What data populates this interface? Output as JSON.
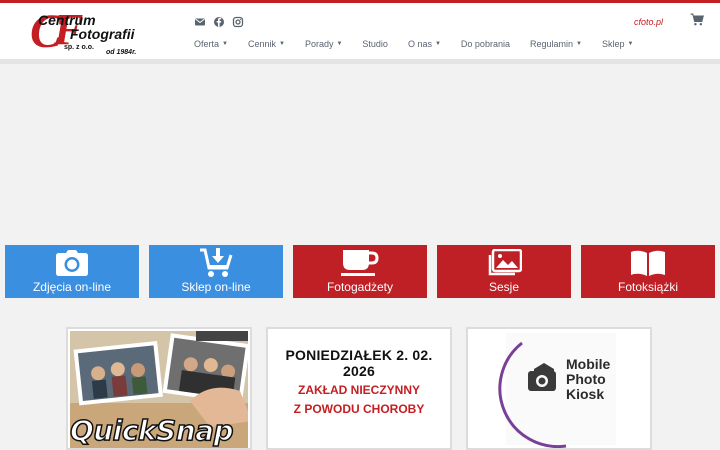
{
  "header": {
    "logo": {
      "line1": "Centrum",
      "line2": "Fotografii",
      "company": "sp. z o.o.",
      "since": "od 1984r."
    },
    "social": [
      {
        "icon": "envelope-icon"
      },
      {
        "icon": "facebook-icon"
      },
      {
        "icon": "instagram-icon"
      }
    ],
    "nav": [
      {
        "label": "Oferta",
        "dropdown": true
      },
      {
        "label": "Cennik",
        "dropdown": true
      },
      {
        "label": "Porady",
        "dropdown": true
      },
      {
        "label": "Studio",
        "dropdown": false
      },
      {
        "label": "O nas",
        "dropdown": true
      },
      {
        "label": "Do pobrania",
        "dropdown": false
      },
      {
        "label": "Regulamin",
        "dropdown": true
      },
      {
        "label": "Sklep",
        "dropdown": true
      }
    ],
    "domain": "cfoto.pl",
    "cart_icon": "shopping-cart-icon"
  },
  "tiles": [
    {
      "label": "Zdjęcia on-line",
      "icon": "camera-icon",
      "color": "#3a8fe0"
    },
    {
      "label": "Sklep on-line",
      "icon": "cart-download-icon",
      "color": "#3a8fe0"
    },
    {
      "label": "Fotogadżety",
      "icon": "coffee-cup-icon",
      "color": "#be2026"
    },
    {
      "label": "Sesje",
      "icon": "images-icon",
      "color": "#be2026"
    },
    {
      "label": "Fotoksiążki",
      "icon": "book-icon",
      "color": "#be2026"
    }
  ],
  "cards": [
    {
      "type": "image",
      "caption": "QuickSnap"
    },
    {
      "type": "notice",
      "line1": "PONIEDZIAŁEK  2. 02. 2026",
      "line2": "ZAKŁAD NIECZYNNY",
      "line3": "Z POWODU CHOROBY"
    },
    {
      "type": "logo",
      "lines": [
        "Mobile",
        "Photo",
        "Kiosk"
      ]
    }
  ],
  "colors": {
    "brand_red": "#c41e22",
    "tile_blue": "#3a8fe0",
    "tile_red": "#be2026"
  }
}
